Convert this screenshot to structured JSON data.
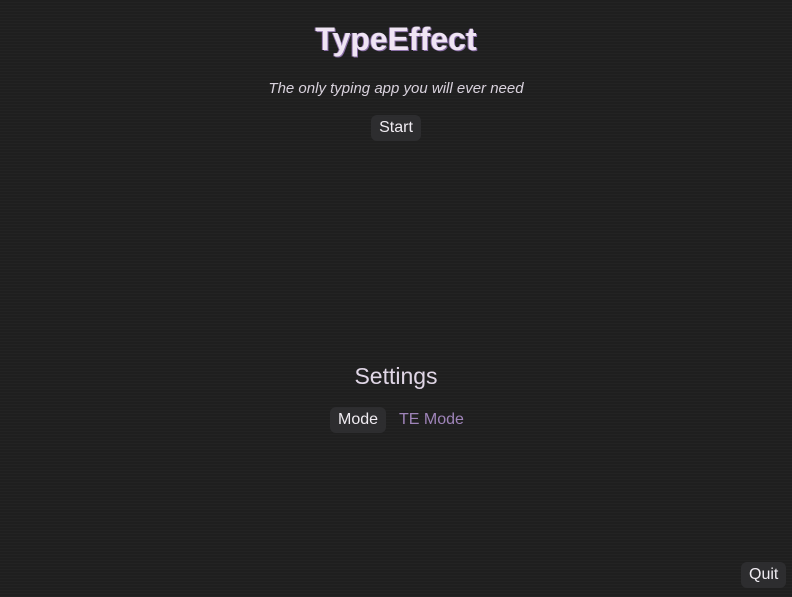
{
  "app": {
    "title": "TypeEffect",
    "tagline": "The only typing app you will ever need"
  },
  "main": {
    "start_label": "Start"
  },
  "settings": {
    "title": "Settings",
    "mode_label": "Mode",
    "mode_value": "TE Mode"
  },
  "footer": {
    "quit_label": "Quit"
  },
  "colors": {
    "background": "#1f1f1f",
    "button_bg": "#2d2d2f",
    "accent": "#9f84b9",
    "title_shadow": "#8a6fa6"
  }
}
